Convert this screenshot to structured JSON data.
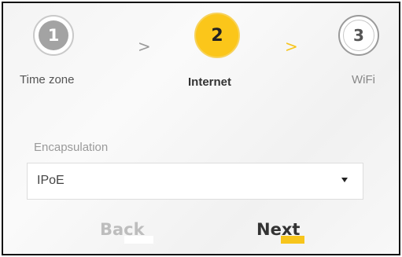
{
  "wizard": {
    "steps": [
      {
        "number": "1",
        "label": "Time zone"
      },
      {
        "number": "2",
        "label": "Internet"
      },
      {
        "number": "3",
        "label": "WiFi"
      }
    ],
    "separator": ">"
  },
  "encapsulation": {
    "label": "Encapsulation",
    "value": "IPoE"
  },
  "buttons": {
    "back": "Back",
    "next": "Next"
  },
  "colors": {
    "accent": "#fbc61a",
    "inactive": "#a3a3a3"
  }
}
